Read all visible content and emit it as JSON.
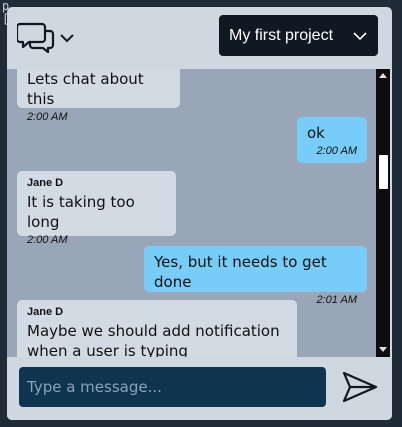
{
  "background": {
    "code_fragment": "p\n["
  },
  "header": {
    "project_name": "My first project"
  },
  "messages": [
    {
      "direction": "in",
      "author": "",
      "text": "Lets chat about this",
      "time": "2:00 AM"
    },
    {
      "direction": "out",
      "author": "",
      "text": "ok",
      "time": "2:00 AM"
    },
    {
      "direction": "in",
      "author": "Jane D",
      "text": "It is taking too long",
      "time": "2:00 AM"
    },
    {
      "direction": "out",
      "author": "",
      "text": "Yes, but it needs to get done",
      "time": "2:01 AM"
    },
    {
      "direction": "in",
      "author": "Jane D",
      "text": "Maybe we should add notification when a user is typing",
      "time": ""
    }
  ],
  "composer": {
    "placeholder": "Type a message..."
  },
  "colors": {
    "incoming_bubble": "#d2dae4",
    "outgoing_bubble": "#78cdf8",
    "message_area": "#99a6b8",
    "input_bg": "#0e3450",
    "project_select_bg": "#0f1923"
  },
  "icons": {
    "header": "chat-bubbles-icon",
    "dropdown": "chevron-down-icon",
    "send": "send-icon"
  }
}
